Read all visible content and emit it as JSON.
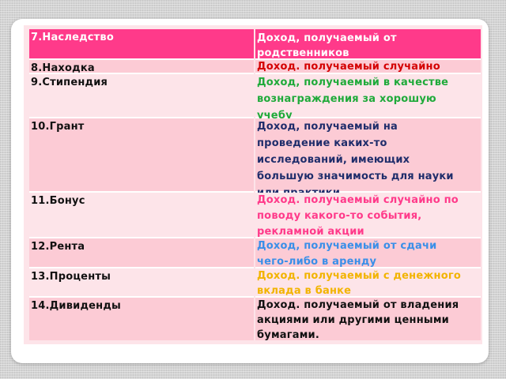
{
  "colors": {
    "header_bg": "#ff3a8a",
    "row_odd": "#fccbd5",
    "row_even": "#fde4e9",
    "text_dark": "#111111",
    "text_navy": "#1f2d6b",
    "text_red": "#d40000",
    "text_green": "#1faa3a",
    "text_pink": "#ff3a8a",
    "text_blue": "#3a8fe8",
    "text_yellow": "#f2b400"
  },
  "terms": [
    {
      "label": "7.Наследство"
    },
    {
      "label": "8.Находка"
    },
    {
      "label": "9.Стипендия"
    },
    {
      "label": "10.Грант"
    },
    {
      "label": "11.Бонус"
    },
    {
      "label": "12.Рента"
    },
    {
      "label": "13.Проценты"
    },
    {
      "label": "14.Дивиденды"
    }
  ],
  "definitions": [
    {
      "lines": [
        "Доход, получаемый от",
        "родственников"
      ]
    },
    {
      "lines": [
        "Доход. получаемый случайно"
      ]
    },
    {
      "lines": [
        "Доход, получаемый в качестве",
        "вознаграждения за хорошую",
        "учебу"
      ]
    },
    {
      "lines": [
        "Доход, получаемый на",
        "проведение каких-то",
        "исследований, имеющих",
        "большую значимость для науки",
        "или практики"
      ]
    },
    {
      "lines": [
        "Доход. получаемый случайно по",
        "поводу какого-то события,",
        "рекламной акции"
      ]
    },
    {
      "lines": [
        "Доход, получаемый от сдачи",
        "чего-либо в аренду"
      ]
    },
    {
      "lines": [
        "Доход. получаемый с денежного",
        "вклада в банке"
      ]
    },
    {
      "lines": [
        "Доход. получаемый от владения",
        "акциями или другими ценными",
        "бумагами."
      ]
    }
  ]
}
